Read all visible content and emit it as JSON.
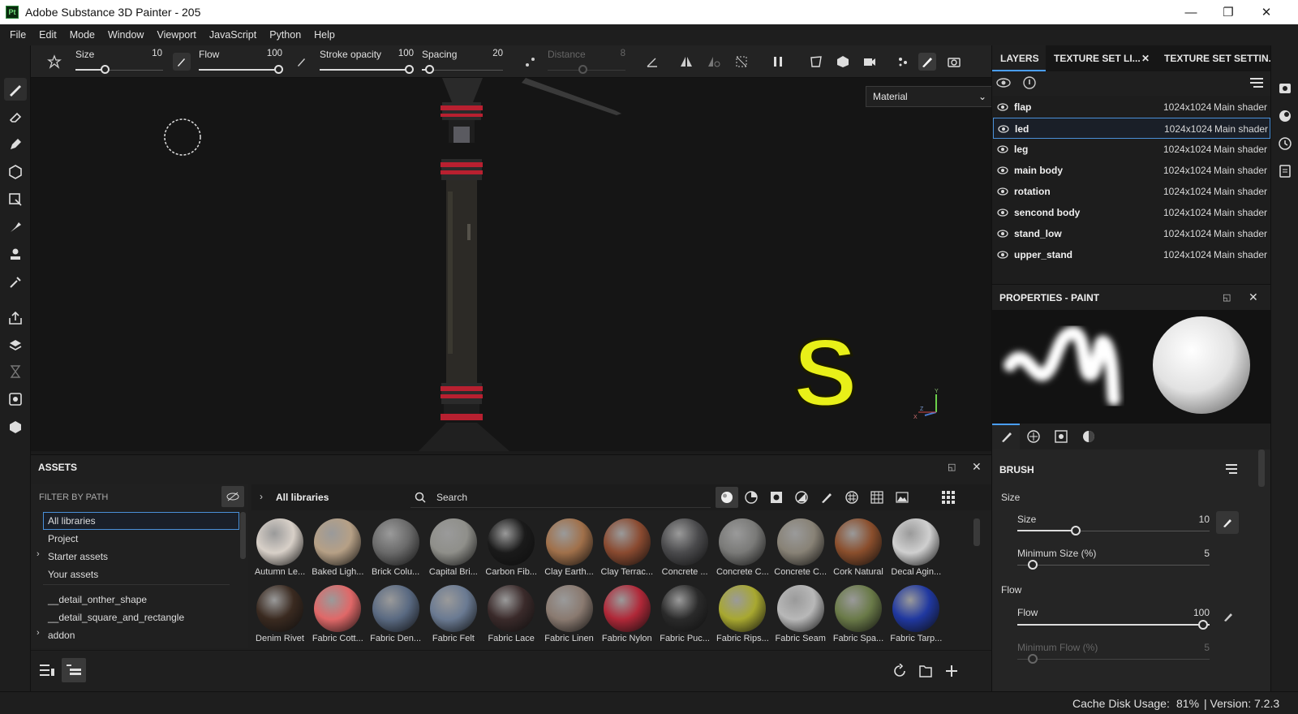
{
  "window": {
    "title": "Adobe Substance 3D Painter - 205",
    "logo_text": "Pt"
  },
  "menu": [
    "File",
    "Edit",
    "Mode",
    "Window",
    "Viewport",
    "JavaScript",
    "Python",
    "Help"
  ],
  "toolbar": {
    "size_label": "Size",
    "size_value": "10",
    "flow_label": "Flow",
    "flow_value": "100",
    "stroke_opacity_label": "Stroke opacity",
    "stroke_opacity_value": "100",
    "spacing_label": "Spacing",
    "spacing_value": "20",
    "distance_label": "Distance",
    "distance_value": "8"
  },
  "viewport": {
    "material_select": "Material",
    "overlay_letter": "S",
    "axis_y": "Y",
    "axis_z": "Z",
    "axis_x": "X"
  },
  "right_tabs": [
    "LAYERS",
    "TEXTURE SET LI...",
    "TEXTURE SET SETTIN..."
  ],
  "layers": [
    {
      "name": "flap",
      "res": "1024x1024",
      "shader": "Main shader"
    },
    {
      "name": "led",
      "res": "1024x1024",
      "shader": "Main shader",
      "selected": true
    },
    {
      "name": "leg",
      "res": "1024x1024",
      "shader": "Main shader"
    },
    {
      "name": "main body",
      "res": "1024x1024",
      "shader": "Main shader"
    },
    {
      "name": "rotation",
      "res": "1024x1024",
      "shader": "Main shader"
    },
    {
      "name": "sencond body",
      "res": "1024x1024",
      "shader": "Main shader"
    },
    {
      "name": "stand_low",
      "res": "1024x1024",
      "shader": "Main shader"
    },
    {
      "name": "upper_stand",
      "res": "1024x1024",
      "shader": "Main shader"
    }
  ],
  "properties": {
    "title": "PROPERTIES - PAINT",
    "section": "BRUSH",
    "size_group": "Size",
    "size_label": "Size",
    "size_value": "10",
    "min_size_label": "Minimum Size (%)",
    "min_size_value": "5",
    "flow_group": "Flow",
    "flow_label": "Flow",
    "flow_value": "100",
    "min_flow_label": "Minimum Flow (%)",
    "min_flow_value": "5"
  },
  "assets": {
    "title": "ASSETS",
    "filter_label": "FILTER BY PATH",
    "tree": [
      "All libraries",
      "Project",
      "Starter assets",
      "Your assets",
      "__detail_onther_shape",
      "__detail_square_and_rectangle",
      "addon"
    ],
    "breadcrumb": "All libraries",
    "search_placeholder": "Search",
    "materials": [
      {
        "name": "Autumn Le...",
        "color": "#d8d0c8"
      },
      {
        "name": "Baked Ligh...",
        "color": "#b6a086"
      },
      {
        "name": "Brick Colu...",
        "color": "#6a6a6a"
      },
      {
        "name": "Capital Bri...",
        "color": "#8f8f8a"
      },
      {
        "name": "Carbon Fib...",
        "color": "#1a1a1a"
      },
      {
        "name": "Clay Earth...",
        "color": "#a0704a"
      },
      {
        "name": "Clay Terrac...",
        "color": "#8a4a30"
      },
      {
        "name": "Concrete ...",
        "color": "#4a4a4c"
      },
      {
        "name": "Concrete C...",
        "color": "#7a7a78"
      },
      {
        "name": "Concrete C...",
        "color": "#888276"
      },
      {
        "name": "Cork Natural",
        "color": "#8a4e2c"
      },
      {
        "name": "Decal Agin...",
        "color": "#cfcfcf"
      },
      {
        "name": "Denim Rivet",
        "color": "#3a2a20"
      },
      {
        "name": "Fabric Cott...",
        "color": "#e06868"
      },
      {
        "name": "Fabric Den...",
        "color": "#5a6a82"
      },
      {
        "name": "Fabric Felt",
        "color": "#6a7a92"
      },
      {
        "name": "Fabric Lace",
        "color": "#3a2a2a"
      },
      {
        "name": "Fabric Linen",
        "color": "#8a7a70"
      },
      {
        "name": "Fabric Nylon",
        "color": "#b02838"
      },
      {
        "name": "Fabric Puc...",
        "color": "#2a2a2a"
      },
      {
        "name": "Fabric Rips...",
        "color": "#a8a830"
      },
      {
        "name": "Fabric Seam",
        "color": "#b8b8b8"
      },
      {
        "name": "Fabric Spa...",
        "color": "#6a7a48"
      },
      {
        "name": "Fabric Tarp...",
        "color": "#2038a0"
      }
    ]
  },
  "status": {
    "cache_label": "Cache Disk Usage:",
    "cache_value": "81%",
    "version": "| Version: 7.2.3"
  },
  "colors": {
    "accent": "#4a9eff",
    "overlay_yellow": "#e8f018"
  }
}
